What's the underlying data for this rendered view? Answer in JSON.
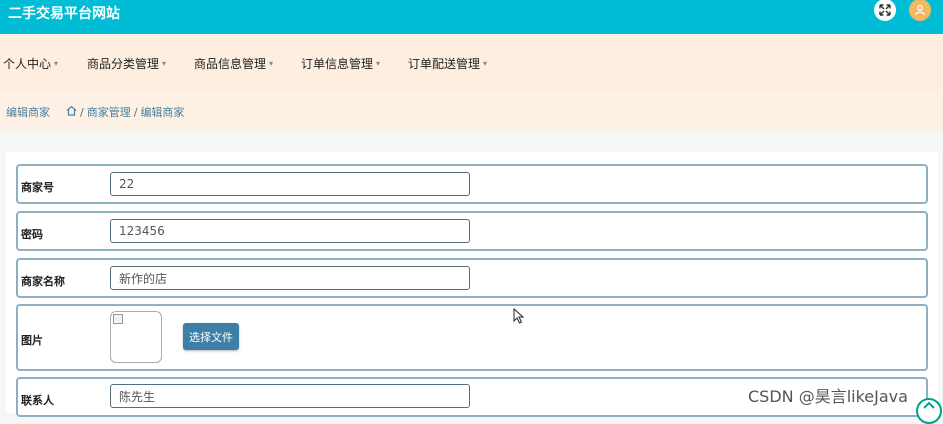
{
  "header": {
    "site_title": "二手交易平台网站",
    "expand_icon": "expand-icon",
    "user_icon": "user-icon"
  },
  "nav": {
    "items": [
      {
        "label": "个人中心"
      },
      {
        "label": "商品分类管理"
      },
      {
        "label": "商品信息管理"
      },
      {
        "label": "订单信息管理"
      },
      {
        "label": "订单配送管理"
      }
    ],
    "caret": "▾"
  },
  "breadcrumb": {
    "page_title": "编辑商家",
    "home_icon": "home-icon",
    "separator": "/",
    "crumbs": [
      "商家管理",
      "编辑商家"
    ]
  },
  "form": {
    "merchant_no_label": "商家号",
    "merchant_no_value": "22",
    "password_label": "密码",
    "password_value": "123456",
    "merchant_name_label": "商家名称",
    "merchant_name_value": "新作的店",
    "image_label": "图片",
    "choose_file_label": "选择文件",
    "contact_label": "联系人",
    "contact_value": "陈先生"
  },
  "watermark": "CSDN @昊言likeJava",
  "colors": {
    "header_bg": "#00bcd4",
    "nav_bg": "#fdeedf",
    "button_bg": "#3d7fa6",
    "row_border": "#8fb0c2"
  }
}
